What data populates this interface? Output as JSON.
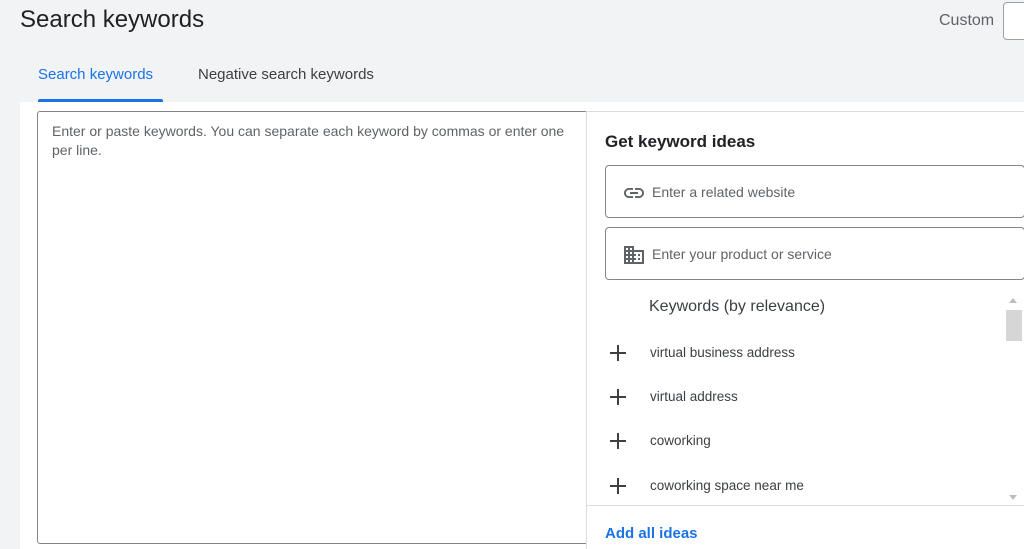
{
  "header": {
    "title": "Search keywords",
    "date_range_label": "Custom"
  },
  "tabs": [
    {
      "label": "Search keywords",
      "active": true
    },
    {
      "label": "Negative search keywords",
      "active": false
    }
  ],
  "keyword_entry": {
    "placeholder": "Enter or paste keywords. You can separate each keyword by commas or enter one per line.",
    "value": ""
  },
  "ideas_panel": {
    "title": "Get keyword ideas",
    "website_input": {
      "placeholder": "Enter a related website",
      "icon": "link-icon"
    },
    "product_input": {
      "placeholder": "Enter your product or service",
      "icon": "business-icon"
    },
    "list_header": "Keywords (by relevance)",
    "keywords": [
      "virtual business address",
      "virtual address",
      "coworking",
      "coworking space near me"
    ],
    "add_all_label": "Add all ideas"
  },
  "colors": {
    "accent": "#1a73e8",
    "background": "#f1f3f4",
    "surface": "#ffffff",
    "border": "#80868b",
    "text_secondary": "#5f6368"
  }
}
